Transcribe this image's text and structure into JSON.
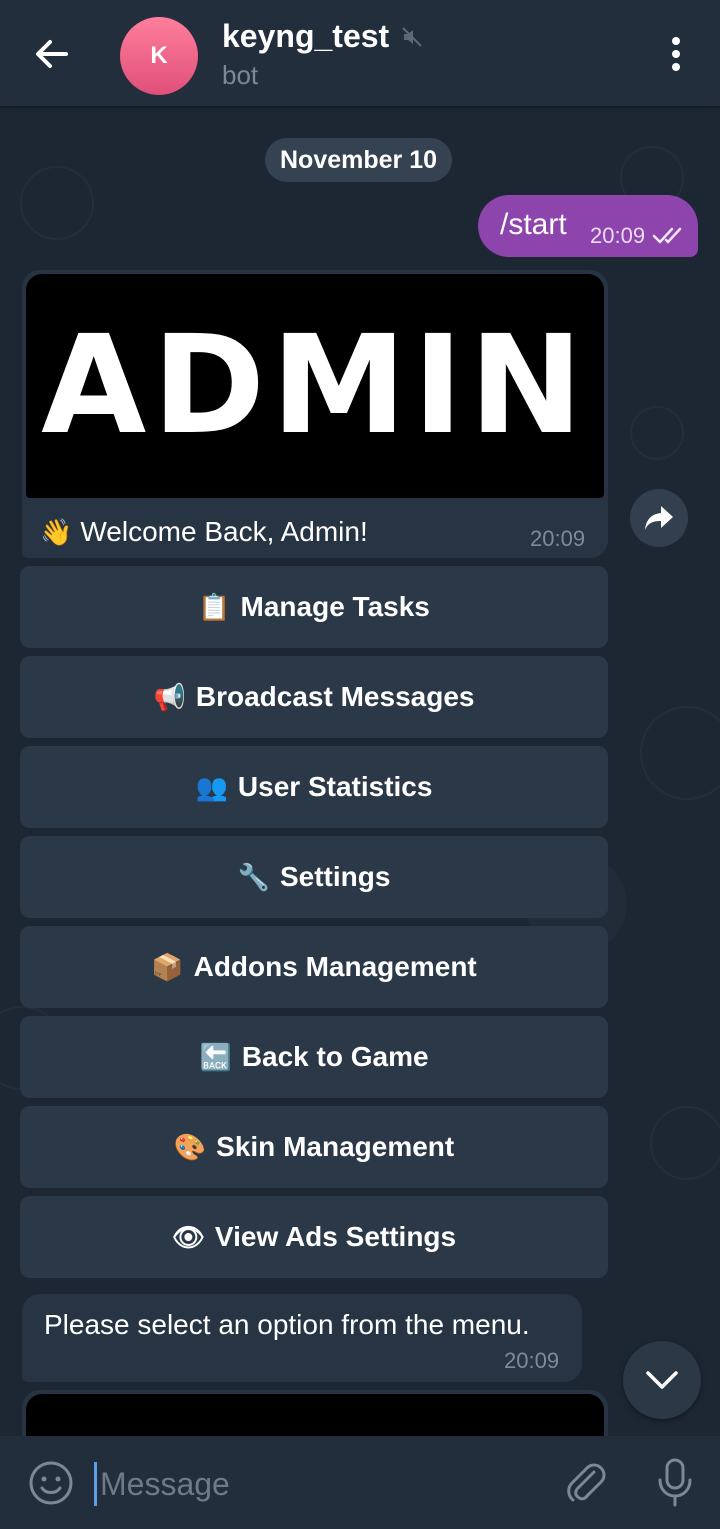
{
  "header": {
    "avatar_letter": "K",
    "title": "keyng_test",
    "subtitle": "bot"
  },
  "chat": {
    "date_label": "November 10",
    "outgoing": {
      "text": "/start",
      "time": "20:09"
    },
    "card": {
      "banner_text": "ADMIN",
      "welcome_emoji": "👋",
      "welcome_text": "Welcome Back, Admin!",
      "time": "20:09"
    },
    "keyboard": [
      {
        "emoji": "📋",
        "label": "Manage Tasks"
      },
      {
        "emoji": "📢",
        "label": "Broadcast Messages"
      },
      {
        "emoji": "👥",
        "label": "User Statistics"
      },
      {
        "emoji": "🔧",
        "label": "Settings"
      },
      {
        "emoji": "📦",
        "label": "Addons Management"
      },
      {
        "emoji": "🔙",
        "label": "Back to Game"
      },
      {
        "emoji": "🎨",
        "label": "Skin Management"
      },
      {
        "emoji": "👁",
        "label": "View Ads Settings"
      }
    ],
    "reply": {
      "text": "Please select an option from the menu.",
      "time": "20:09"
    }
  },
  "input": {
    "placeholder": "Message"
  },
  "colors": {
    "header_bg": "#232e3c",
    "outgoing_bubble": "#8e44ad",
    "incoming_bubble": "#273443",
    "avatar": "#e85b84"
  }
}
